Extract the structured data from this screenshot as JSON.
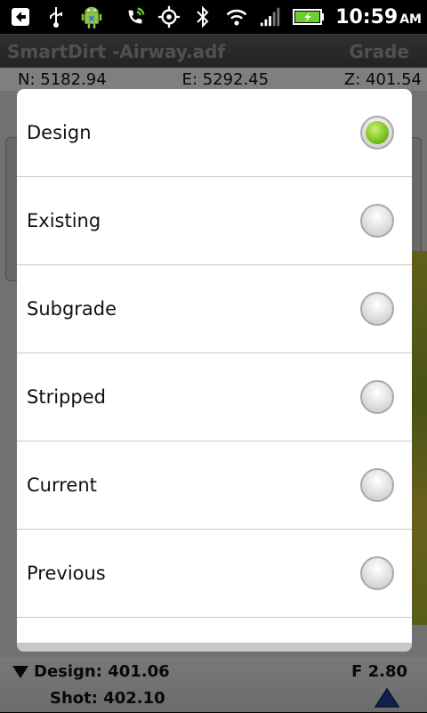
{
  "status_bar": {
    "time": "10:59",
    "ampm": "AM",
    "icons": [
      "back-notification-icon",
      "usb-icon",
      "android-debug-icon",
      "phone-signal-icon",
      "gps-icon",
      "bluetooth-icon",
      "wifi-icon",
      "cell-signal-icon",
      "battery-charging-icon"
    ]
  },
  "app": {
    "title": "SmartDirt -Airway.adf",
    "mode": "Grade"
  },
  "coords": {
    "n": "N: 5182.94",
    "e": "E: 5292.45",
    "z": "Z: 401.54"
  },
  "dialog": {
    "options": [
      {
        "label": "Design",
        "checked": true
      },
      {
        "label": "Existing",
        "checked": false
      },
      {
        "label": "Subgrade",
        "checked": false
      },
      {
        "label": "Stripped",
        "checked": false
      },
      {
        "label": "Current",
        "checked": false
      },
      {
        "label": "Previous",
        "checked": false
      }
    ]
  },
  "bottom": {
    "design": "Design: 401.06",
    "shot": "Shot: 402.10",
    "f_value": "F 2.80"
  },
  "colors": {
    "radio_selected": "#7ec51f",
    "arrow_up": "#1f3f9a"
  }
}
